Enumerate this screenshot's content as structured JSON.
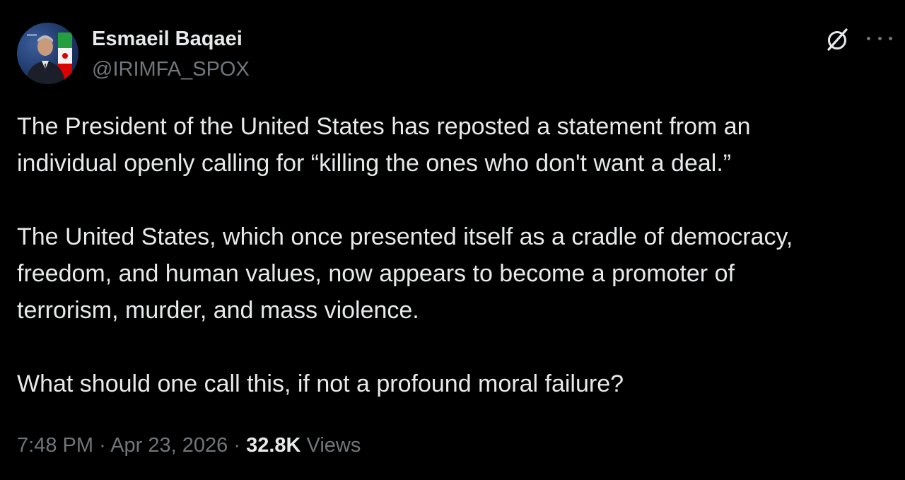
{
  "author": {
    "name": "Esmaeil Baqaei",
    "handle": "@IRIMFA_SPOX"
  },
  "icons": {
    "grok": "grok-icon",
    "more": "more-options-icon"
  },
  "post": {
    "paragraphs": [
      {
        "lines": [
          "The President of the United States has reposted a statement from an",
          "individual openly calling for “killing the ones who don't want a deal.”"
        ]
      },
      {
        "lines": [
          "The United States, which once presented itself as a cradle of democracy,",
          "freedom, and human values, now appears to become a promoter of",
          "terrorism, murder, and mass violence."
        ]
      },
      {
        "lines": [
          "What should one call this, if not a profound moral failure?"
        ]
      }
    ]
  },
  "meta": {
    "time": "7:48 PM",
    "separator": "·",
    "date": "Apr 23, 2026",
    "views_count": "32.8K",
    "views_label": "Views"
  },
  "colors": {
    "background": "#000000",
    "primary_text": "#e7e9ea",
    "secondary_text": "#71767b"
  }
}
